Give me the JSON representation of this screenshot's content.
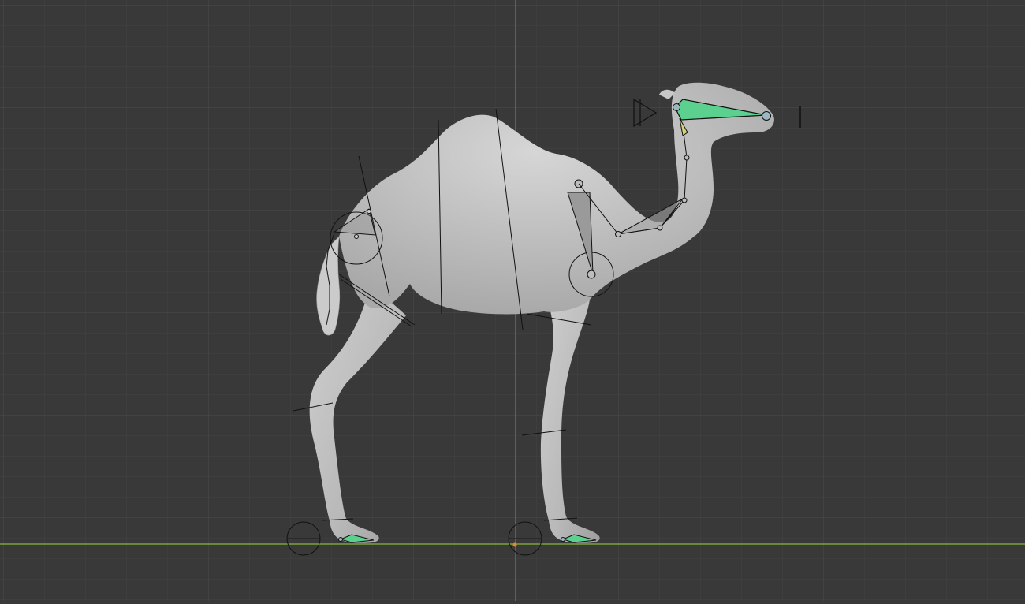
{
  "viewport": {
    "view": "side-orthographic",
    "background_color": "#393939",
    "grid_minor_color": "#424242",
    "grid_major_color": "#4a4a4a",
    "x_axis_color": "#7aa33a",
    "z_axis_color": "#4f6fa8",
    "mesh_color": "#bdbdbd",
    "bone_color": "#9a9a9a",
    "selected_bone_color": "#5bd08f",
    "active_bone_tip_color": "#d9d07a"
  },
  "scene_objects": [
    {
      "name": "camel-mesh",
      "type": "mesh"
    },
    {
      "name": "camel-armature",
      "type": "armature"
    },
    {
      "name": "camera",
      "type": "camera",
      "icon": "camera-icon"
    }
  ]
}
